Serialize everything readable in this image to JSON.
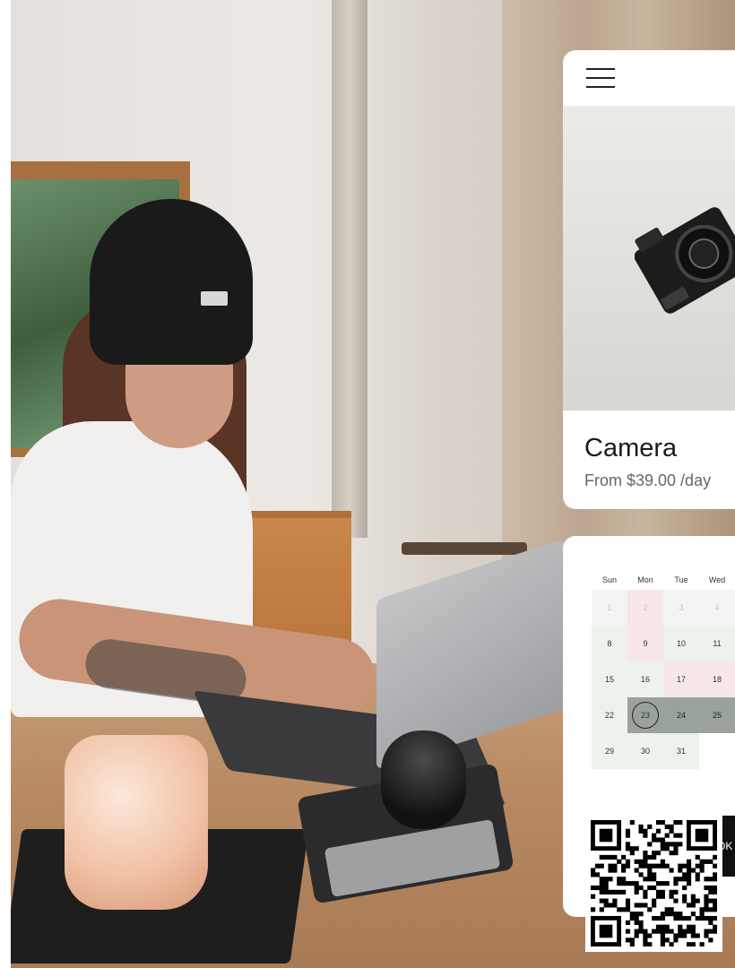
{
  "product": {
    "title": "Camera",
    "price": "From $39.00 /day"
  },
  "calendar": {
    "weekdays": [
      "Sun",
      "Mon",
      "Tue",
      "Wed"
    ],
    "rows": [
      [
        "1",
        "2",
        "3",
        "4"
      ],
      [
        "8",
        "9",
        "10",
        "11"
      ],
      [
        "15",
        "16",
        "17",
        "18"
      ],
      [
        "22",
        "23",
        "24",
        "25"
      ],
      [
        "29",
        "30",
        "31",
        ""
      ]
    ],
    "selected_day": "23"
  },
  "book_button": {
    "label": "OK"
  },
  "icons": [
    "hamburger-menu-icon",
    "qr-code"
  ],
  "colors": {
    "accent": "#9aa39a",
    "button": "#111111"
  }
}
